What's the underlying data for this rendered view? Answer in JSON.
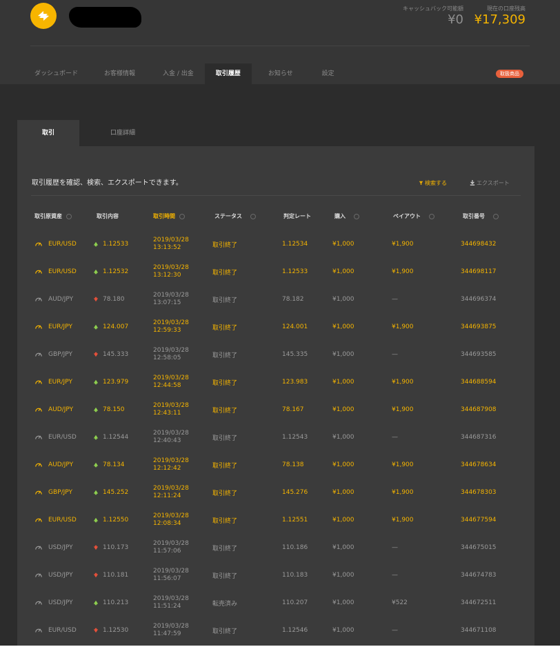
{
  "header": {
    "balances": {
      "cashback_label": "キャッシュバック可能額",
      "cashback_value": "¥0",
      "account_label": "現在の口座残高",
      "account_value": "¥17,309"
    },
    "nav": [
      {
        "label": "ダッシュボード"
      },
      {
        "label": "お客様情報"
      },
      {
        "label": "入金 / 出金"
      },
      {
        "label": "取引履歴"
      },
      {
        "label": "お知らせ"
      },
      {
        "label": "設定"
      }
    ],
    "badge": "取扱商品"
  },
  "subtabs": [
    {
      "label": "取引"
    },
    {
      "label": "口座詳細"
    }
  ],
  "description": "取引履歴を確認、検索、エクスポートできます。",
  "tools": {
    "search": "検索する",
    "export": "エクスポート"
  },
  "colors": {
    "accent": "#f5b400",
    "up": "#8fd14f",
    "down": "#e8503a",
    "badge": "#e8603c"
  },
  "table": {
    "headers": [
      "取引原資産",
      "取引内容",
      "取引時間",
      "ステータス",
      "判定レート",
      "購入",
      "ペイアウト",
      "取引番号"
    ],
    "rows": [
      {
        "asset": "EUR/USD",
        "dir": "up",
        "rate_in": "1.12533",
        "date": "2019/03/28",
        "time": "13:13:52",
        "status": "取引終了",
        "rate_out": "1.12534",
        "amount": "¥1,000",
        "payout": "¥1,900",
        "id": "344698432",
        "win": true
      },
      {
        "asset": "EUR/USD",
        "dir": "up",
        "rate_in": "1.12532",
        "date": "2019/03/28",
        "time": "13:12:30",
        "status": "取引終了",
        "rate_out": "1.12533",
        "amount": "¥1,000",
        "payout": "¥1,900",
        "id": "344698117",
        "win": true
      },
      {
        "asset": "AUD/JPY",
        "dir": "down",
        "rate_in": "78.180",
        "date": "2019/03/28",
        "time": "13:07:15",
        "status": "取引終了",
        "rate_out": "78.182",
        "amount": "¥1,000",
        "payout": "—",
        "id": "344696374",
        "win": false
      },
      {
        "asset": "EUR/JPY",
        "dir": "up",
        "rate_in": "124.007",
        "date": "2019/03/28",
        "time": "12:59:33",
        "status": "取引終了",
        "rate_out": "124.001",
        "amount": "¥1,000",
        "payout": "¥1,900",
        "id": "344693875",
        "win": true
      },
      {
        "asset": "GBP/JPY",
        "dir": "down",
        "rate_in": "145.333",
        "date": "2019/03/28",
        "time": "12:58:05",
        "status": "取引終了",
        "rate_out": "145.335",
        "amount": "¥1,000",
        "payout": "—",
        "id": "344693585",
        "win": false
      },
      {
        "asset": "EUR/JPY",
        "dir": "up",
        "rate_in": "123.979",
        "date": "2019/03/28",
        "time": "12:44:58",
        "status": "取引終了",
        "rate_out": "123.983",
        "amount": "¥1,000",
        "payout": "¥1,900",
        "id": "344688594",
        "win": true
      },
      {
        "asset": "AUD/JPY",
        "dir": "up",
        "rate_in": "78.150",
        "date": "2019/03/28",
        "time": "12:43:11",
        "status": "取引終了",
        "rate_out": "78.167",
        "amount": "¥1,000",
        "payout": "¥1,900",
        "id": "344687908",
        "win": true
      },
      {
        "asset": "EUR/USD",
        "dir": "up",
        "rate_in": "1.12544",
        "date": "2019/03/28",
        "time": "12:40:43",
        "status": "取引終了",
        "rate_out": "1.12543",
        "amount": "¥1,000",
        "payout": "—",
        "id": "344687316",
        "win": false
      },
      {
        "asset": "AUD/JPY",
        "dir": "up",
        "rate_in": "78.134",
        "date": "2019/03/28",
        "time": "12:12:42",
        "status": "取引終了",
        "rate_out": "78.138",
        "amount": "¥1,000",
        "payout": "¥1,900",
        "id": "344678634",
        "win": true
      },
      {
        "asset": "GBP/JPY",
        "dir": "up",
        "rate_in": "145.252",
        "date": "2019/03/28",
        "time": "12:11:24",
        "status": "取引終了",
        "rate_out": "145.276",
        "amount": "¥1,000",
        "payout": "¥1,900",
        "id": "344678303",
        "win": true
      },
      {
        "asset": "EUR/USD",
        "dir": "up",
        "rate_in": "1.12550",
        "date": "2019/03/28",
        "time": "12:08:34",
        "status": "取引終了",
        "rate_out": "1.12551",
        "amount": "¥1,000",
        "payout": "¥1,900",
        "id": "344677594",
        "win": true
      },
      {
        "asset": "USD/JPY",
        "dir": "down",
        "rate_in": "110.173",
        "date": "2019/03/28",
        "time": "11:57:06",
        "status": "取引終了",
        "rate_out": "110.186",
        "amount": "¥1,000",
        "payout": "—",
        "id": "344675015",
        "win": false
      },
      {
        "asset": "USD/JPY",
        "dir": "down",
        "rate_in": "110.181",
        "date": "2019/03/28",
        "time": "11:56:07",
        "status": "取引終了",
        "rate_out": "110.183",
        "amount": "¥1,000",
        "payout": "—",
        "id": "344674783",
        "win": false
      },
      {
        "asset": "USD/JPY",
        "dir": "up",
        "rate_in": "110.213",
        "date": "2019/03/28",
        "time": "11:51:24",
        "status": "転売済み",
        "rate_out": "110.207",
        "amount": "¥1,000",
        "payout": "¥522",
        "id": "344672511",
        "win": false
      },
      {
        "asset": "EUR/USD",
        "dir": "down",
        "rate_in": "1.12530",
        "date": "2019/03/28",
        "time": "11:47:59",
        "status": "取引終了",
        "rate_out": "1.12546",
        "amount": "¥1,000",
        "payout": "—",
        "id": "344671108",
        "win": false
      }
    ]
  }
}
